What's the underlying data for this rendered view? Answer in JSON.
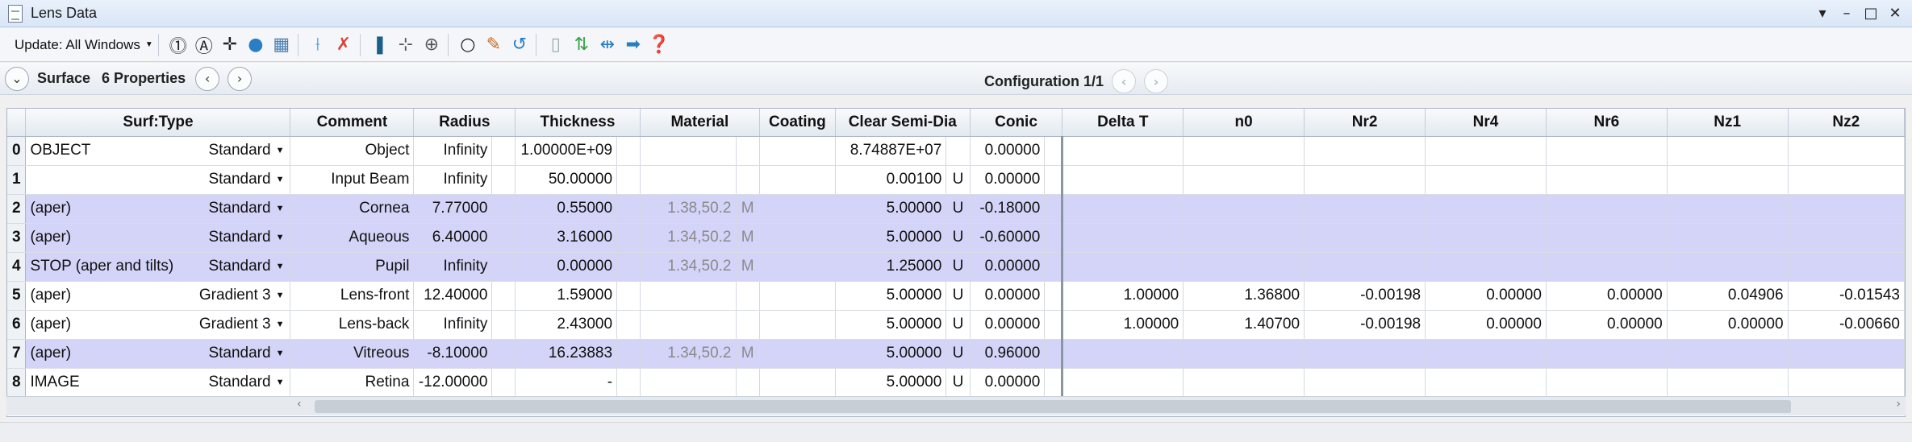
{
  "window": {
    "title": "Lens Data"
  },
  "toolbar": {
    "update_label": "Update: All Windows"
  },
  "header": {
    "surface_label": "Surface",
    "properties_label": "6 Properties",
    "configuration_label": "Configuration 1/1"
  },
  "columns": [
    "Surf:Type",
    "Comment",
    "Radius",
    "Thickness",
    "Material",
    "Coating",
    "Clear Semi-Dia",
    "Conic",
    "Delta T",
    "n0",
    "Nr2",
    "Nr4",
    "Nr6",
    "Nz1",
    "Nz2"
  ],
  "rows": [
    {
      "num": "0",
      "label": "OBJECT",
      "type": "Standard",
      "comment": "Object",
      "radius": "Infinity",
      "thickness": "1.00000E+09",
      "material": "",
      "material_solve": "",
      "coating": "",
      "semi_dia": "8.74887E+07",
      "semi_dia_solve": "",
      "conic": "0.00000",
      "delta_t": "",
      "n0": "",
      "nr2": "",
      "nr4": "",
      "nr6": "",
      "nz1": "",
      "nz2": ""
    },
    {
      "num": "1",
      "label": "",
      "type": "Standard",
      "comment": "Input Beam",
      "radius": "Infinity",
      "thickness": "50.00000",
      "material": "",
      "material_solve": "",
      "coating": "",
      "semi_dia": "0.00100",
      "semi_dia_solve": "U",
      "conic": "0.00000",
      "delta_t": "",
      "n0": "",
      "nr2": "",
      "nr4": "",
      "nr6": "",
      "nz1": "",
      "nz2": ""
    },
    {
      "num": "2",
      "label": "(aper)",
      "type": "Standard",
      "comment": "Cornea",
      "radius": "7.77000",
      "thickness": "0.55000",
      "material": "1.38,50.2",
      "material_solve": "M",
      "coating": "",
      "semi_dia": "5.00000",
      "semi_dia_solve": "U",
      "conic": "-0.18000",
      "delta_t": "",
      "n0": "",
      "nr2": "",
      "nr4": "",
      "nr6": "",
      "nz1": "",
      "nz2": ""
    },
    {
      "num": "3",
      "label": "(aper)",
      "type": "Standard",
      "comment": "Aqueous",
      "radius": "6.40000",
      "thickness": "3.16000",
      "material": "1.34,50.2",
      "material_solve": "M",
      "coating": "",
      "semi_dia": "5.00000",
      "semi_dia_solve": "U",
      "conic": "-0.60000",
      "delta_t": "",
      "n0": "",
      "nr2": "",
      "nr4": "",
      "nr6": "",
      "nz1": "",
      "nz2": ""
    },
    {
      "num": "4",
      "label": "STOP (aper and tilts)",
      "type": "Standard",
      "comment": "Pupil",
      "radius": "Infinity",
      "thickness": "0.00000",
      "material": "1.34,50.2",
      "material_solve": "M",
      "coating": "",
      "semi_dia": "1.25000",
      "semi_dia_solve": "U",
      "conic": "0.00000",
      "delta_t": "",
      "n0": "",
      "nr2": "",
      "nr4": "",
      "nr6": "",
      "nz1": "",
      "nz2": ""
    },
    {
      "num": "5",
      "label": "(aper)",
      "type": "Gradient 3",
      "comment": "Lens-front",
      "radius": "12.40000",
      "thickness": "1.59000",
      "material": "",
      "material_solve": "",
      "coating": "",
      "semi_dia": "5.00000",
      "semi_dia_solve": "U",
      "conic": "0.00000",
      "delta_t": "1.00000",
      "n0": "1.36800",
      "nr2": "-0.00198",
      "nr4": "0.00000",
      "nr6": "0.00000",
      "nz1": "0.04906",
      "nz2": "-0.01543"
    },
    {
      "num": "6",
      "label": "(aper)",
      "type": "Gradient 3",
      "comment": "Lens-back",
      "radius": "Infinity",
      "thickness": "2.43000",
      "material": "",
      "material_solve": "",
      "coating": "",
      "semi_dia": "5.00000",
      "semi_dia_solve": "U",
      "conic": "0.00000",
      "delta_t": "1.00000",
      "n0": "1.40700",
      "nr2": "-0.00198",
      "nr4": "0.00000",
      "nr6": "0.00000",
      "nz1": "0.00000",
      "nz2": "-0.00660"
    },
    {
      "num": "7",
      "label": "(aper)",
      "type": "Standard",
      "comment": "Vitreous",
      "radius": "-8.10000",
      "thickness": "16.23883",
      "material": "1.34,50.2",
      "material_solve": "M",
      "coating": "",
      "semi_dia": "5.00000",
      "semi_dia_solve": "U",
      "conic": "0.96000",
      "delta_t": "",
      "n0": "",
      "nr2": "",
      "nr4": "",
      "nr6": "",
      "nz1": "",
      "nz2": ""
    },
    {
      "num": "8",
      "label": "IMAGE",
      "type": "Standard",
      "comment": "Retina",
      "radius": "-12.00000",
      "thickness": "-",
      "material": "",
      "material_solve": "",
      "coating": "",
      "semi_dia": "5.00000",
      "semi_dia_solve": "U",
      "conic": "0.00000",
      "delta_t": "",
      "n0": "",
      "nr2": "",
      "nr4": "",
      "nr6": "",
      "nz1": "",
      "nz2": ""
    }
  ],
  "highlight_color": "#d3d4f7"
}
